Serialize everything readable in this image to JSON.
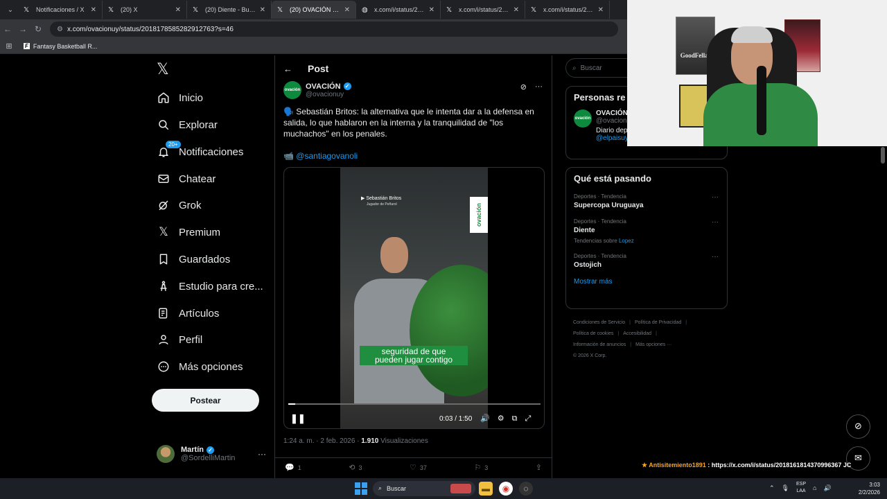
{
  "browser": {
    "tabs": [
      {
        "title": "Notificaciones / X",
        "icon": "x-logo-icon",
        "active": false
      },
      {
        "title": "(20) X",
        "icon": "x-logo-icon",
        "active": false
      },
      {
        "title": "(20) Diente - Buscar /",
        "icon": "x-logo-icon",
        "active": false
      },
      {
        "title": "(20) OVACIÓN en X: \"",
        "icon": "x-logo-icon",
        "active": true
      },
      {
        "title": "x.com/i/status/20181",
        "icon": "globe-icon",
        "active": false
      },
      {
        "title": "x.com/i/status/20181",
        "icon": "x-logo-icon",
        "active": false
      },
      {
        "title": "x.com/i/status/20181",
        "icon": "x-logo-icon",
        "active": false
      }
    ],
    "url": "x.com/ovacionuy/status/2018178585282912763?s=46",
    "bookmark": "Fantasy Basketball R..."
  },
  "nav": {
    "items": [
      {
        "label": "Inicio",
        "icon": "home-icon"
      },
      {
        "label": "Explorar",
        "icon": "search-icon"
      },
      {
        "label": "Notificaciones",
        "icon": "bell-icon",
        "badge": "20+"
      },
      {
        "label": "Chatear",
        "icon": "mail-icon"
      },
      {
        "label": "Grok",
        "icon": "grok-icon"
      },
      {
        "label": "Premium",
        "icon": "x-logo-icon"
      },
      {
        "label": "Guardados",
        "icon": "bookmark-icon"
      },
      {
        "label": "Estudio para cre...",
        "icon": "studio-icon"
      },
      {
        "label": "Artículos",
        "icon": "article-icon"
      },
      {
        "label": "Perfil",
        "icon": "person-icon"
      },
      {
        "label": "Más opciones",
        "icon": "more-circle-icon"
      }
    ],
    "post_button": "Postear",
    "account": {
      "name": "Martín",
      "handle": "@SordelliMartin"
    }
  },
  "post": {
    "header_title": "Post",
    "author": {
      "name": "OVACIÓN",
      "handle": "@ovacionuy",
      "avatar_text": "ovación"
    },
    "text": "🗣️ Sebastián Britos: la alternativa que le intenta dar a la defensa en salida, lo que hablaron en la interna y la tranquilidad de \"los muchachos\" en los penales.",
    "credit_icon": "📹",
    "credit_mention": "@santiagovanoli",
    "video": {
      "tag_name": "▶ Sebastián Britos",
      "tag_sub": "Jugador de Peñarol",
      "logo": "ovación",
      "caption_line1": "seguridad de que",
      "caption_line2": "pueden jugar contigo",
      "time": "0:03 / 1:50",
      "progress": 0.027
    },
    "meta_time": "1:24 a. m. · 2 feb. 2026 · ",
    "views_count": "1.910",
    "views_label": " Visualizaciones",
    "stats": {
      "replies": "1",
      "reposts": "3",
      "likes": "37",
      "bookmarks": "3"
    }
  },
  "right": {
    "search_placeholder": "Buscar",
    "who_title": "Personas re",
    "who": {
      "name": "OVACIÓN",
      "handle": "@ovacion",
      "bio": "Diario dep",
      "bio_link": "@elpaisuy",
      "avatar_text": "ovación"
    },
    "trends_title": "Qué está pasando",
    "trends": [
      {
        "category": "Deportes · Tendencia",
        "name": "Supercopa Uruguaya",
        "extra": "",
        "extra_link": ""
      },
      {
        "category": "Deportes · Tendencia",
        "name": "Diente",
        "extra": "Tendencias sobre ",
        "extra_link": "Lopez"
      },
      {
        "category": "Deportes · Tendencia",
        "name": "Ostojich",
        "extra": "",
        "extra_link": ""
      }
    ],
    "show_more": "Mostrar más",
    "footer_line1": [
      "Condiciones de Servicio",
      "Política de Privacidad"
    ],
    "footer_line2": [
      "Política de cookies",
      "Accesibilidad"
    ],
    "footer_line3": [
      "Información de anuncios",
      "Más opciones ···"
    ],
    "copyright": "© 2026 X Corp."
  },
  "stream": {
    "poster_title": "GoodFellas",
    "chat_user": "★ Antisitemiento1891",
    "chat_text": " : https://x.com/i/status/2018161814370996367 JC"
  },
  "taskbar": {
    "search_label": "Buscar",
    "lang_top": "ESP",
    "lang_bottom": "LAA",
    "time": "3:03",
    "date": "2/2/2026"
  }
}
